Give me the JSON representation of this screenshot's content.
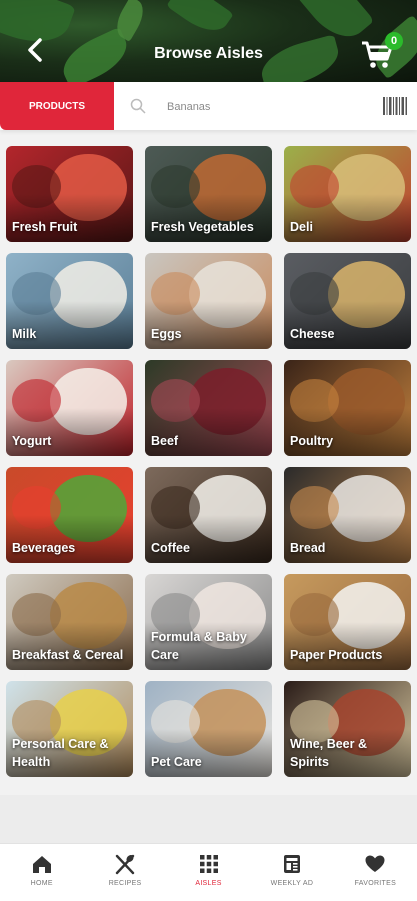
{
  "header": {
    "title": "Browse Aisles",
    "cart_count": "0"
  },
  "search": {
    "tab_label": "PRODUCTS",
    "placeholder": "Bananas"
  },
  "aisles": [
    {
      "label": "Fresh Fruit",
      "colors": [
        "#b3262c",
        "#e35a45",
        "#5a1716"
      ]
    },
    {
      "label": "Fresh Vegetables",
      "colors": [
        "#4d5a55",
        "#c06a34",
        "#2d3a2e"
      ]
    },
    {
      "label": "Deli",
      "colors": [
        "#9bb04a",
        "#d8c07a",
        "#c1412f"
      ]
    },
    {
      "label": "Milk",
      "colors": [
        "#8fb2c8",
        "#f2efe6",
        "#5b7e96"
      ]
    },
    {
      "label": "Eggs",
      "colors": [
        "#c9c6c0",
        "#e8e3da",
        "#c98a5c"
      ]
    },
    {
      "label": "Cheese",
      "colors": [
        "#5a5d62",
        "#d9b46b",
        "#3b3d40"
      ]
    },
    {
      "label": "Yogurt",
      "colors": [
        "#d9c9c0",
        "#f6f1ea",
        "#c0222a"
      ]
    },
    {
      "label": "Beef",
      "colors": [
        "#2c3a27",
        "#7a1f2a",
        "#a64a55"
      ]
    },
    {
      "label": "Poultry",
      "colors": [
        "#3a2418",
        "#9a5a2c",
        "#c4823e"
      ]
    },
    {
      "label": "Beverages",
      "colors": [
        "#c94a2a",
        "#4fa83a",
        "#e8402f"
      ]
    },
    {
      "label": "Coffee",
      "colors": [
        "#7d6a5c",
        "#f5f2ec",
        "#3a2a1e"
      ]
    },
    {
      "label": "Bread",
      "colors": [
        "#2a2a2a",
        "#eae7e4",
        "#c68a4e"
      ]
    },
    {
      "label": "Breakfast & Cereal",
      "colors": [
        "#cfcac0",
        "#b98a48",
        "#8a6a4a"
      ]
    },
    {
      "label": "Formula & Baby Care",
      "colors": [
        "#d8d6d4",
        "#f0e6e0",
        "#8a8a8a"
      ]
    },
    {
      "label": "Paper Products",
      "colors": [
        "#c69a5e",
        "#f4f4f2",
        "#9a6a3e"
      ]
    },
    {
      "label": "Personal Care & Health",
      "colors": [
        "#cfe2ea",
        "#e8d04a",
        "#b08a5a"
      ]
    },
    {
      "label": "Pet Care",
      "colors": [
        "#9fb2c4",
        "#c4925a",
        "#e8e4de"
      ]
    },
    {
      "label": "Wine, Beer & Spirits",
      "colors": [
        "#2a1c18",
        "#a4442e",
        "#d8c8a0"
      ]
    }
  ],
  "tabs": [
    {
      "label": "HOME",
      "icon": "home-icon"
    },
    {
      "label": "RECIPES",
      "icon": "utensils-icon"
    },
    {
      "label": "AISLES",
      "icon": "grid-icon",
      "active": true
    },
    {
      "label": "WEEKLY AD",
      "icon": "newspaper-icon"
    },
    {
      "label": "FAVORITES",
      "icon": "heart-icon"
    }
  ],
  "colors": {
    "accent": "#e0263a",
    "badge": "#2bbb2b",
    "header_bg": "#1a2e18"
  }
}
